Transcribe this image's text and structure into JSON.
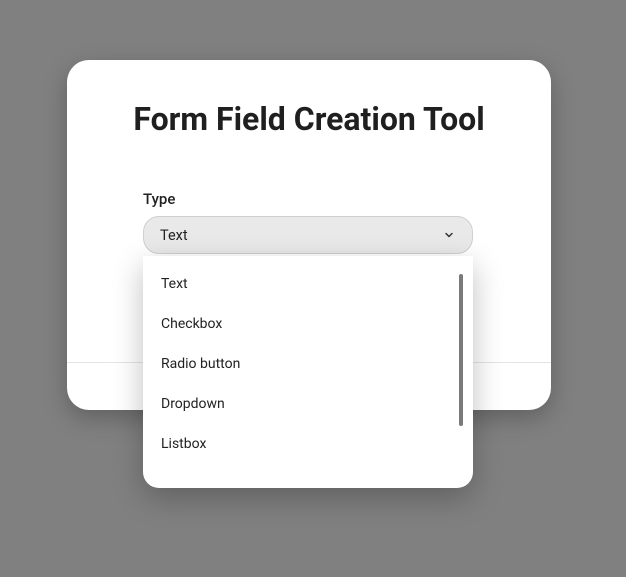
{
  "title": "Form Field Creation Tool",
  "field": {
    "label": "Type",
    "selected": "Text",
    "options": [
      "Text",
      "Checkbox",
      "Radio button",
      "Dropdown",
      "Listbox"
    ]
  }
}
